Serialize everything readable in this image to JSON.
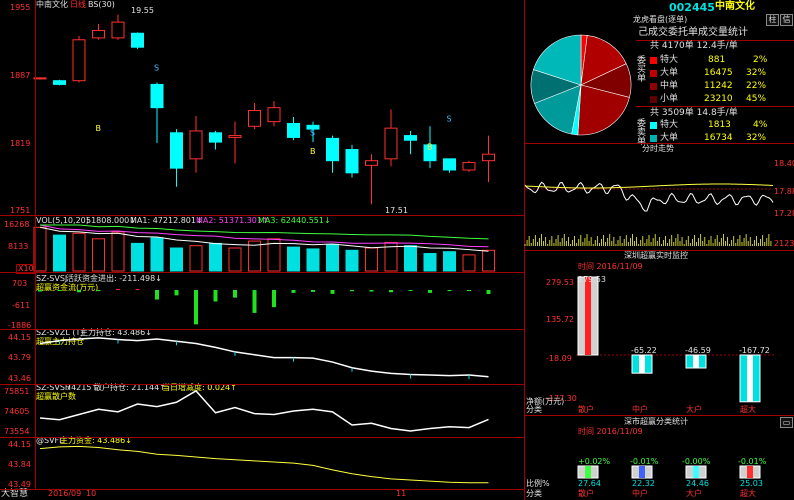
{
  "kline": {
    "title": "中南文化",
    "period_tag": "日线",
    "indicator": "BS(30)",
    "high_label": "19.55",
    "low_label": "17.51",
    "price_axis": [
      "1955",
      "1887",
      "1819",
      "1751"
    ],
    "signals": [
      "B",
      "S",
      "B",
      "S",
      "B",
      "S"
    ],
    "candles": [
      {
        "o": 18.86,
        "c": 18.87,
        "h": 18.88,
        "l": 18.85,
        "up": true
      },
      {
        "o": 18.84,
        "c": 18.8,
        "h": 18.85,
        "l": 18.79,
        "up": false
      },
      {
        "o": 18.84,
        "c": 19.28,
        "h": 19.32,
        "l": 18.82,
        "up": true
      },
      {
        "o": 19.3,
        "c": 19.38,
        "h": 19.45,
        "l": 19.28,
        "up": true
      },
      {
        "o": 19.3,
        "c": 19.47,
        "h": 19.55,
        "l": 19.28,
        "up": true
      },
      {
        "o": 19.35,
        "c": 19.2,
        "h": 19.36,
        "l": 19.18,
        "up": false
      },
      {
        "o": 18.8,
        "c": 18.55,
        "h": 18.82,
        "l": 18.17,
        "up": false
      },
      {
        "o": 17.9,
        "c": 18.28,
        "h": 18.32,
        "l": 17.7,
        "up": false
      },
      {
        "o": 18.0,
        "c": 18.3,
        "h": 18.46,
        "l": 17.85,
        "up": true
      },
      {
        "o": 18.28,
        "c": 18.18,
        "h": 18.3,
        "l": 18.1,
        "up": false
      },
      {
        "o": 18.23,
        "c": 18.25,
        "h": 18.4,
        "l": 17.95,
        "up": true
      },
      {
        "o": 18.35,
        "c": 18.52,
        "h": 18.6,
        "l": 18.32,
        "up": true
      },
      {
        "o": 18.4,
        "c": 18.55,
        "h": 18.62,
        "l": 18.35,
        "up": true
      },
      {
        "o": 18.38,
        "c": 18.23,
        "h": 18.45,
        "l": 18.2,
        "up": false
      },
      {
        "o": 18.36,
        "c": 18.32,
        "h": 18.4,
        "l": 18.18,
        "up": false
      },
      {
        "o": 18.22,
        "c": 17.98,
        "h": 18.25,
        "l": 17.85,
        "up": false
      },
      {
        "o": 18.1,
        "c": 17.85,
        "h": 18.15,
        "l": 17.8,
        "up": false
      },
      {
        "o": 17.93,
        "c": 17.98,
        "h": 18.05,
        "l": 17.51,
        "up": true
      },
      {
        "o": 18.0,
        "c": 18.33,
        "h": 18.53,
        "l": 17.92,
        "up": true
      },
      {
        "o": 18.25,
        "c": 18.2,
        "h": 18.3,
        "l": 18.05,
        "up": false
      },
      {
        "o": 18.15,
        "c": 17.98,
        "h": 18.35,
        "l": 17.9,
        "up": false
      },
      {
        "o": 18.0,
        "c": 17.88,
        "h": 18.0,
        "l": 17.85,
        "up": false
      },
      {
        "o": 17.88,
        "c": 17.96,
        "h": 17.98,
        "l": 17.86,
        "up": true
      },
      {
        "o": 17.98,
        "c": 18.05,
        "h": 18.25,
        "l": 17.75,
        "up": true
      }
    ]
  },
  "vol": {
    "label": "VOL(5,10,20)",
    "value": "51808.000↓",
    "ma1": "MA1: 47212.801↓",
    "ma2": "MA2: 51371.301↑",
    "ma3": "MA3: 62440.551↓",
    "axis": [
      "16268",
      "8133",
      "X10"
    ],
    "values": [
      95,
      78,
      82,
      70,
      85,
      60,
      72,
      50,
      55,
      60,
      50,
      65,
      70,
      52,
      48,
      58,
      45,
      50,
      62,
      55,
      38,
      42,
      35,
      45
    ]
  },
  "fund": {
    "label": "SZ-SVSJ",
    "sublabel": "超赢资金流(万元)",
    "value_text": "活跃资金进出: -211.498↓",
    "axis": [
      "703",
      "-611",
      "-1886"
    ],
    "values": [
      -80,
      -40,
      -120,
      -60,
      40,
      20,
      -500,
      -280,
      -1800,
      -600,
      -400,
      -1200,
      -900,
      -150,
      -100,
      -200,
      -60,
      -80,
      -120,
      -40,
      -150,
      -60,
      -30,
      -211
    ]
  },
  "main": {
    "label": "SZ-SVZL (T)",
    "value_text": "主力持仓: 43.486↓",
    "sublabel": "超赢主力持仓",
    "axis": [
      "44.15",
      "43.79",
      "43.46"
    ],
    "values": [
      44.05,
      44.1,
      44.13,
      44.15,
      44.12,
      44.1,
      44.13,
      44.09,
      44.05,
      43.98,
      43.9,
      43.85,
      43.8,
      43.8,
      43.79,
      43.72,
      43.62,
      43.56,
      43.52,
      43.5,
      43.49,
      43.48,
      43.49,
      43.46
    ]
  },
  "retail": {
    "label": "SZ-SVSH",
    "value1": "74215↑",
    "value2": "散户持仓: 21.144↑",
    "value3": "当日增减度: 0.024↑",
    "sublabel": "超赢散户数",
    "axis": [
      "75851",
      "74605",
      "73554"
    ],
    "values": [
      74300,
      74200,
      74500,
      74800,
      74650,
      75100,
      74950,
      75200,
      75851,
      74600,
      74900,
      74550,
      74500,
      74700,
      74800,
      74650,
      73900,
      74000,
      73700,
      73554,
      73700,
      73800,
      73750,
      74215
    ]
  },
  "svfl": {
    "label": "@SVFL",
    "value_text": "主力资金: 43.486↓",
    "axis": [
      "44.15",
      "43.84",
      "43.49"
    ],
    "values": [
      44.1,
      44.13,
      44.14,
      44.12,
      44.08,
      44.05,
      44.0,
      43.98,
      43.95,
      43.92,
      43.9,
      43.88,
      43.86,
      43.84,
      43.8,
      43.72,
      43.65,
      43.6,
      43.56,
      43.54,
      43.52,
      43.5,
      43.49,
      43.49
    ]
  },
  "bottom": {
    "brand": "大智慧",
    "date": "2016/09",
    "day": "10",
    "marker": "11"
  },
  "right": {
    "code": "002445",
    "name": "中南文化",
    "btn1": "柱",
    "btn2": "信",
    "dragon": "龙虎看盘(逐单)",
    "stat_title": "己成交委托单成交量统计",
    "buy_label": "委买单",
    "sell_label": "委卖单",
    "buy_total": "共 4170单 12.4手/单",
    "sell_total": "共 3509单 14.8手/单",
    "buy_rows": [
      {
        "name": "特大",
        "vol": "881",
        "pct": "2%",
        "color": "#ff0000"
      },
      {
        "name": "大单",
        "vol": "16475",
        "pct": "32%",
        "color": "#c00000"
      },
      {
        "name": "中单",
        "vol": "11242",
        "pct": "22%",
        "color": "#900000"
      },
      {
        "name": "小单",
        "vol": "23210",
        "pct": "45%",
        "color": "#600000"
      }
    ],
    "sell_rows": [
      {
        "name": "特大",
        "vol": "1813",
        "pct": "4%",
        "color": "#00ffff"
      },
      {
        "name": "大单",
        "vol": "16734",
        "pct": "32%",
        "color": "#00b0b0"
      }
    ],
    "pie": [
      {
        "value": 2,
        "color": "#ff0000"
      },
      {
        "value": 16,
        "color": "#b00000"
      },
      {
        "value": 11,
        "color": "#800000"
      },
      {
        "value": 22,
        "color": "#a00000"
      },
      {
        "value": 2,
        "color": "#00ffff"
      },
      {
        "value": 16,
        "color": "#009a9a"
      },
      {
        "value": 11,
        "color": "#007070"
      },
      {
        "value": 20,
        "color": "#00b8b8"
      }
    ],
    "timeline_title": "分时走势",
    "timeline_axis": [
      "18.40",
      "17.88",
      "17.28",
      "2123"
    ],
    "monitor_title": "深圳超赢实时监控",
    "monitor_time": "时间  2016/11/09",
    "monitor_axis": [
      "279.53",
      "135.72",
      "-18.09",
      "-177.30"
    ],
    "monitor_ylabel": "净额(万元)",
    "monitor_xlabel": "分类",
    "monitor_cats": [
      {
        "name": "散户",
        "value": "279.53",
        "v": 279.53
      },
      {
        "name": "中户",
        "value": "-65.22",
        "v": -65.22
      },
      {
        "name": "大户",
        "value": "-46.59",
        "v": -46.59
      },
      {
        "name": "超大",
        "value": "-167.72",
        "v": -167.72
      }
    ],
    "cls_title": "深市超赢分类统计",
    "cls_time": "时间  2016/11/09",
    "cls_ylabel": "比例%",
    "cls_xlabel": "分类",
    "cls_cats": [
      {
        "name": "散户",
        "top": "+0.02%",
        "bot": "27.64",
        "color": "#40ff40"
      },
      {
        "name": "中户",
        "top": "-0.01%",
        "bot": "22.32",
        "color": "#4060ff"
      },
      {
        "name": "大户",
        "top": "-0.00%",
        "bot": "24.46",
        "color": "#40ffff"
      },
      {
        "name": "超大",
        "top": "-0.01%",
        "bot": "25.03",
        "color": "#ff3030"
      }
    ]
  }
}
